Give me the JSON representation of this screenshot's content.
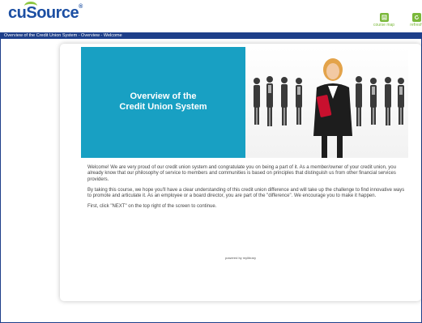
{
  "app": {
    "logo_cu": "cu",
    "logo_source": "ource",
    "logo_reg": "®"
  },
  "toolbar": {
    "course_map_label": "course map",
    "refresh_label": "refresh"
  },
  "breadcrumb": {
    "text": "Overview of the Credit Union System - Overview - Welcome"
  },
  "banner": {
    "title_line1": "Overview of the",
    "title_line2": "Credit Union System"
  },
  "content": {
    "paragraph1": "Welcome! We are very proud of our credit union system and congratulate you on being a part of it. As a member/owner of your credit union, you already know that our philosophy of service to members and communities is based on principles that distinguish us from other financial services providers.",
    "paragraph2": "By taking this course, we hope you'll have a clear understanding of this credit union difference and will take up the challenge to find innovative ways to promote and articulate it. As an employee or a board director, you are part of the \"difference\". We encourage you to make it happen.",
    "paragraph3": "First, click \"NEXT\" on the top right of the screen to continue.",
    "powered_by": "powered by mylibrary"
  },
  "colors": {
    "brand_blue": "#1c4fa3",
    "title_bar": "#1e3f8a",
    "banner_teal": "#18a0c3",
    "tool_green": "#7ab83a"
  }
}
